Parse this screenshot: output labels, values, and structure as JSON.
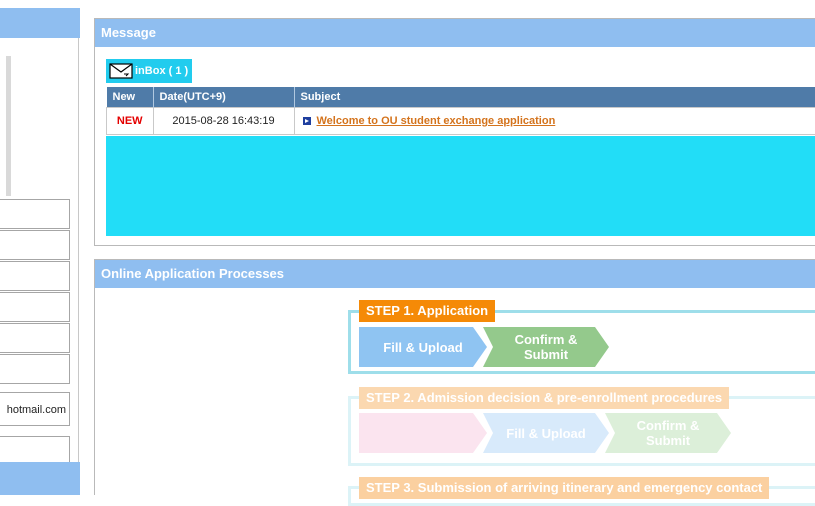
{
  "sidebar": {
    "email_value": "hotmail.com"
  },
  "message_panel": {
    "title": "Message",
    "inbox_label": "inBox ( 1 )",
    "columns": [
      "New",
      "Date(UTC+9)",
      "Subject"
    ],
    "rows": [
      {
        "new": "NEW",
        "date": "2015-08-28 16:43:19",
        "subject": "Welcome to OU student exchange application"
      }
    ]
  },
  "process_panel": {
    "title": "Online Application Processes",
    "steps": [
      {
        "label": "STEP 1. Application",
        "tasks": [
          "Fill & Upload",
          "Confirm & Submit"
        ]
      },
      {
        "label": "STEP 2. Admission decision & pre-enrollment procedures",
        "tasks": [
          "",
          "Fill & Upload",
          "Confirm & Submit"
        ]
      },
      {
        "label": "STEP 3. Submission of arriving itinerary and emergency contact"
      }
    ]
  },
  "colors": {
    "header_blue": "#8fbef0",
    "table_header": "#4f7ba8",
    "inbox_cyan": "#22ccee",
    "step_orange": "#f58a07",
    "task_blue": "#8fc4f2",
    "task_green": "#94c98c",
    "new_red": "#e40000",
    "link_orange": "#d4731c"
  }
}
